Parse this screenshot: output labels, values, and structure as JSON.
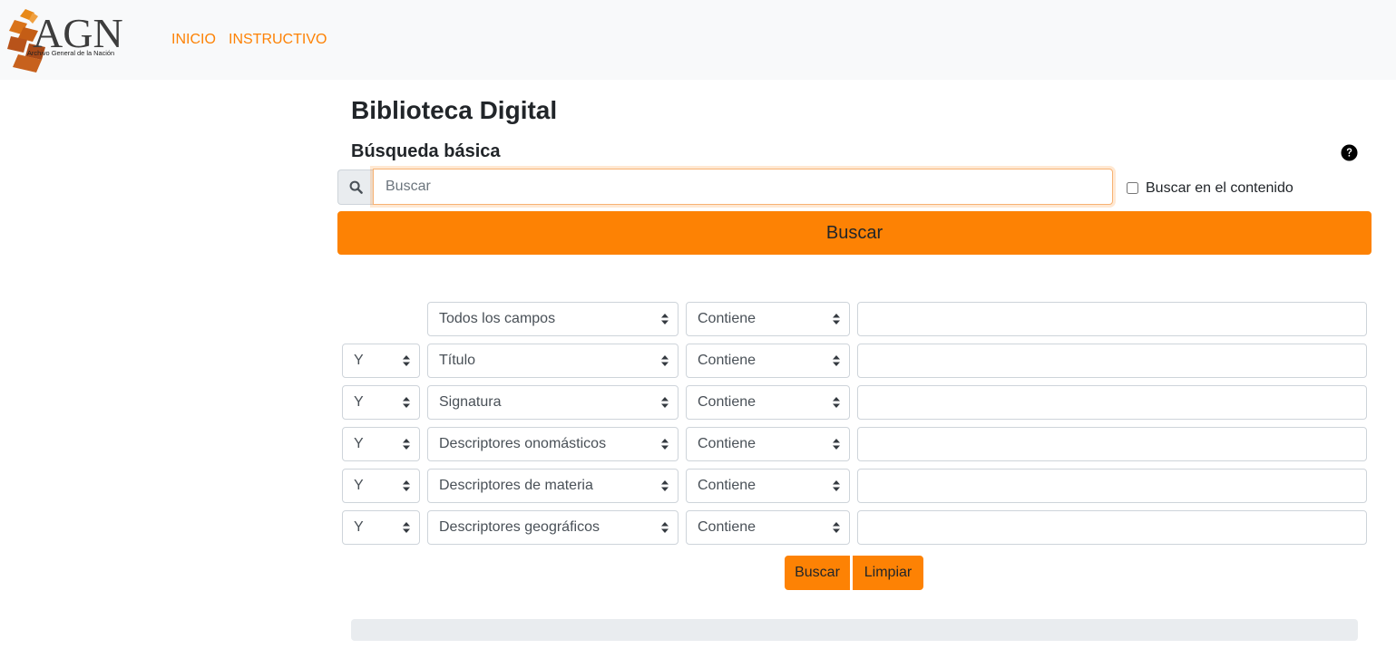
{
  "brand": {
    "logo_text": "AGN",
    "logo_subtitle": "Archivo General de la Nación",
    "accent_color": "#fd8204"
  },
  "nav": {
    "items": [
      {
        "label": "INICIO"
      },
      {
        "label": "INSTRUCTIVO"
      }
    ]
  },
  "page": {
    "title": "Biblioteca Digital",
    "section_title": "Búsqueda básica",
    "help_icon": "question-circle-icon"
  },
  "basic_search": {
    "placeholder": "Buscar",
    "value": "",
    "icon": "search-icon",
    "content_checkbox_label": "Buscar en el contenido",
    "content_checkbox_checked": false,
    "button_label": "Buscar"
  },
  "advanced_search": {
    "rows": [
      {
        "operator": "",
        "field": "Todos los campos",
        "condition": "Contiene",
        "value": ""
      },
      {
        "operator": "Y",
        "field": "Título",
        "condition": "Contiene",
        "value": ""
      },
      {
        "operator": "Y",
        "field": "Signatura",
        "condition": "Contiene",
        "value": ""
      },
      {
        "operator": "Y",
        "field": "Descriptores onomásticos",
        "condition": "Contiene",
        "value": ""
      },
      {
        "operator": "Y",
        "field": "Descriptores de materia",
        "condition": "Contiene",
        "value": ""
      },
      {
        "operator": "Y",
        "field": "Descriptores geográficos",
        "condition": "Contiene",
        "value": ""
      }
    ],
    "search_label": "Buscar",
    "clear_label": "Limpiar"
  }
}
